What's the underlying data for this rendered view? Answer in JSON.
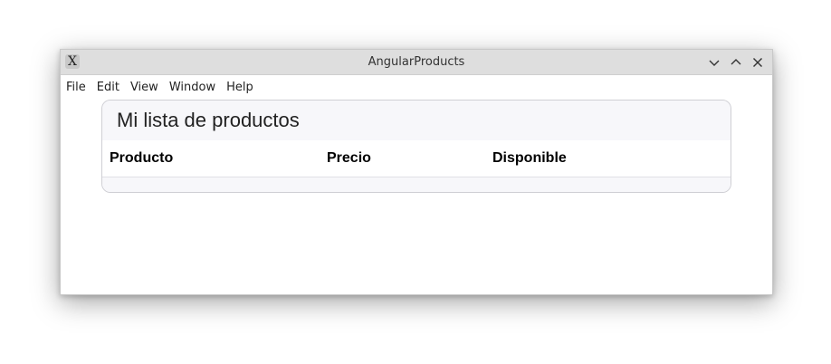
{
  "window": {
    "title": "AngularProducts",
    "app_icon_glyph": "X",
    "controls": [
      "minimize-icon",
      "maximize-icon",
      "close-icon"
    ]
  },
  "menubar": {
    "items": [
      "File",
      "Edit",
      "View",
      "Window",
      "Help"
    ]
  },
  "content": {
    "heading": "Mi lista de productos",
    "table": {
      "columns": [
        "Producto",
        "Precio",
        "Disponible"
      ],
      "rows": []
    }
  }
}
